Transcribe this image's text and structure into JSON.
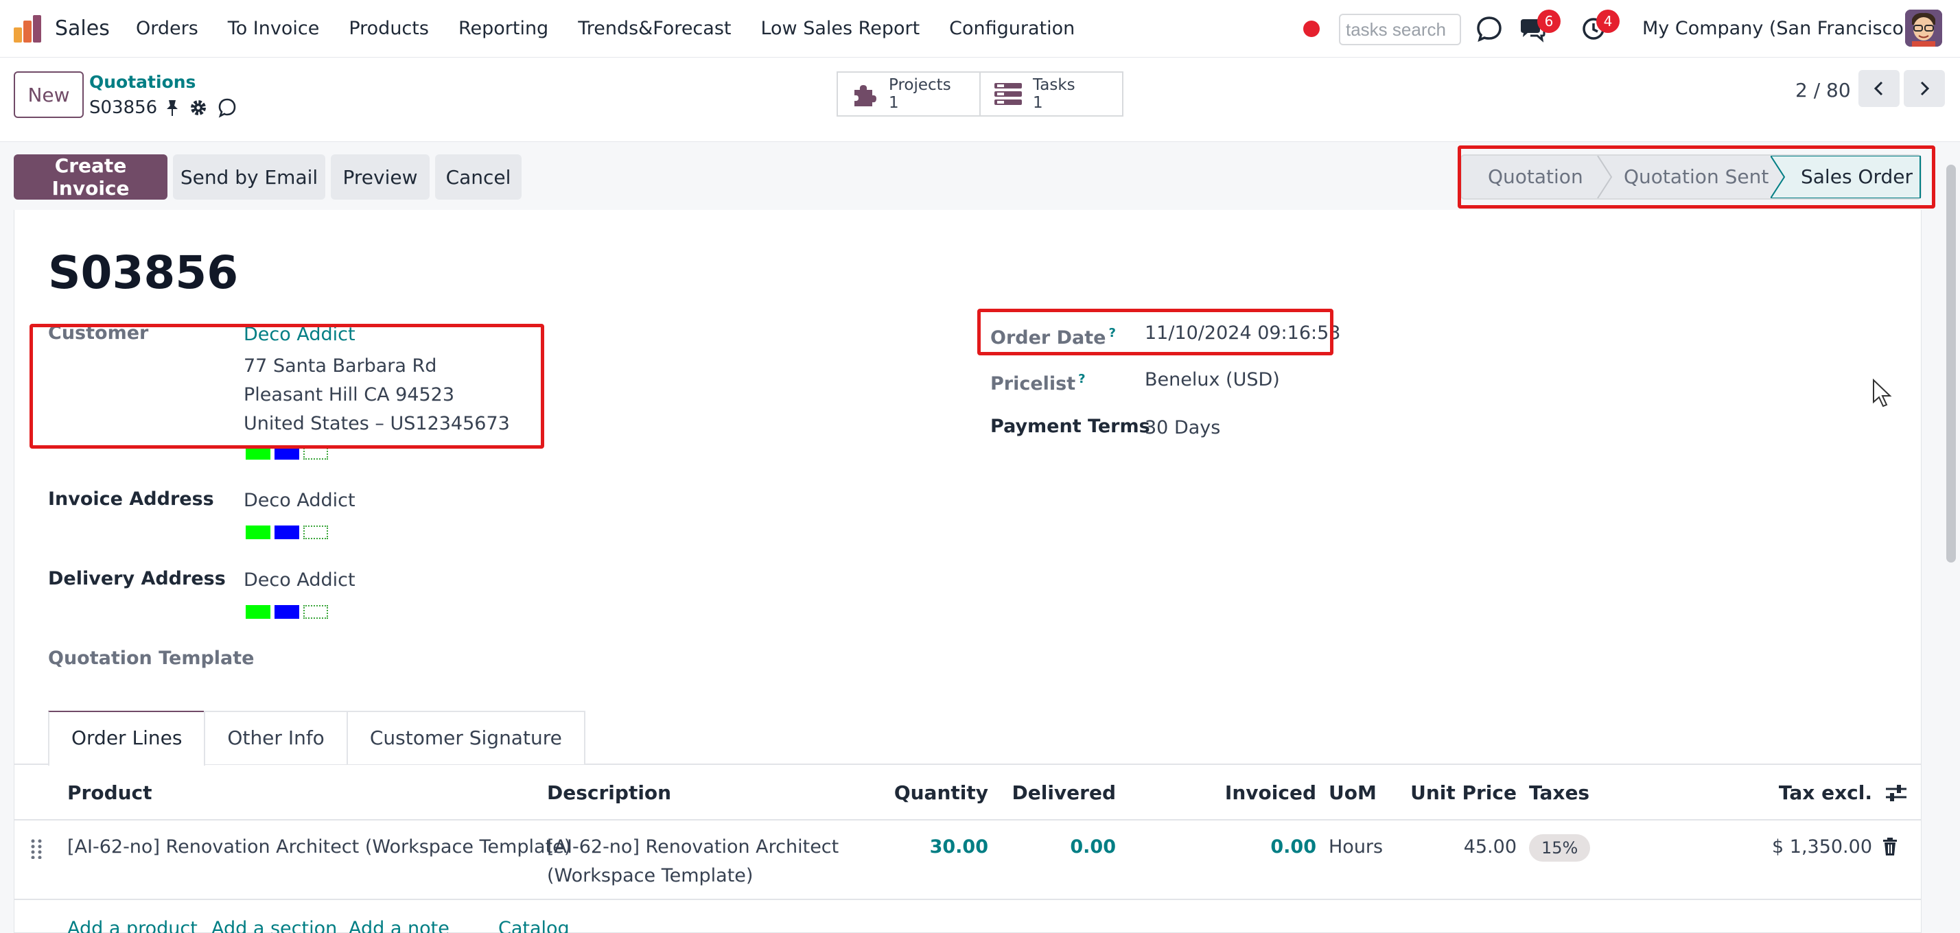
{
  "navbar": {
    "app_name": "Sales",
    "menu": [
      "Orders",
      "To Invoice",
      "Products",
      "Reporting",
      "Trends&Forecast",
      "Low Sales Report",
      "Configuration"
    ],
    "search_placeholder": "tasks search",
    "messages_count": "6",
    "activities_count": "4",
    "company": "My Company (San Francisco)"
  },
  "control_panel": {
    "new_label": "New",
    "breadcrumb": "Quotations",
    "record_name": "S03856",
    "smart_buttons": [
      {
        "label": "Projects",
        "count": "1",
        "icon": "puzzle-icon"
      },
      {
        "label": "Tasks",
        "count": "1",
        "icon": "tasks-icon"
      }
    ],
    "pager": "2 / 80"
  },
  "actions": {
    "create_invoice": "Create Invoice",
    "send_email": "Send by Email",
    "preview": "Preview",
    "cancel": "Cancel"
  },
  "status": {
    "steps": [
      "Quotation",
      "Quotation Sent",
      "Sales Order"
    ],
    "current": "Sales Order"
  },
  "form": {
    "title": "S03856",
    "customer_label": "Customer",
    "customer_name": "Deco Addict",
    "address": [
      "77 Santa Barbara Rd",
      "Pleasant Hill CA 94523",
      "United States – US12345673"
    ],
    "invoice_address_label": "Invoice Address",
    "invoice_address": "Deco Addict",
    "delivery_address_label": "Delivery Address",
    "delivery_address": "Deco Addict",
    "quotation_template_label": "Quotation Template",
    "order_date_label": "Order Date",
    "order_date": "11/10/2024 09:16:53",
    "pricelist_label": "Pricelist",
    "pricelist": "Benelux (USD)",
    "payment_terms_label": "Payment Terms",
    "payment_terms": "30 Days",
    "help_mark": "?"
  },
  "tabs": [
    "Order Lines",
    "Other Info",
    "Customer Signature"
  ],
  "order_lines": {
    "columns": [
      "Product",
      "Description",
      "Quantity",
      "Delivered",
      "Invoiced",
      "UoM",
      "Unit Price",
      "Taxes",
      "Tax excl."
    ],
    "rows": [
      {
        "product": "[AI-62-no] Renovation Architect (Workspace Template)",
        "description_line1": "[AI-62-no] Renovation Architect",
        "description_line2": "(Workspace Template)",
        "quantity": "30.00",
        "delivered": "0.00",
        "invoiced": "0.00",
        "uom": "Hours",
        "unit_price": "45.00",
        "taxes": "15%",
        "subtotal": "$ 1,350.00"
      }
    ],
    "add_links": [
      "Add a product",
      "Add a section",
      "Add a note",
      "Catalog"
    ]
  },
  "colors": {
    "brand": "#714b67",
    "link": "#017e84",
    "highlight": "#e2191b",
    "swatch_green": "#00ff00",
    "swatch_blue": "#0000ff"
  }
}
